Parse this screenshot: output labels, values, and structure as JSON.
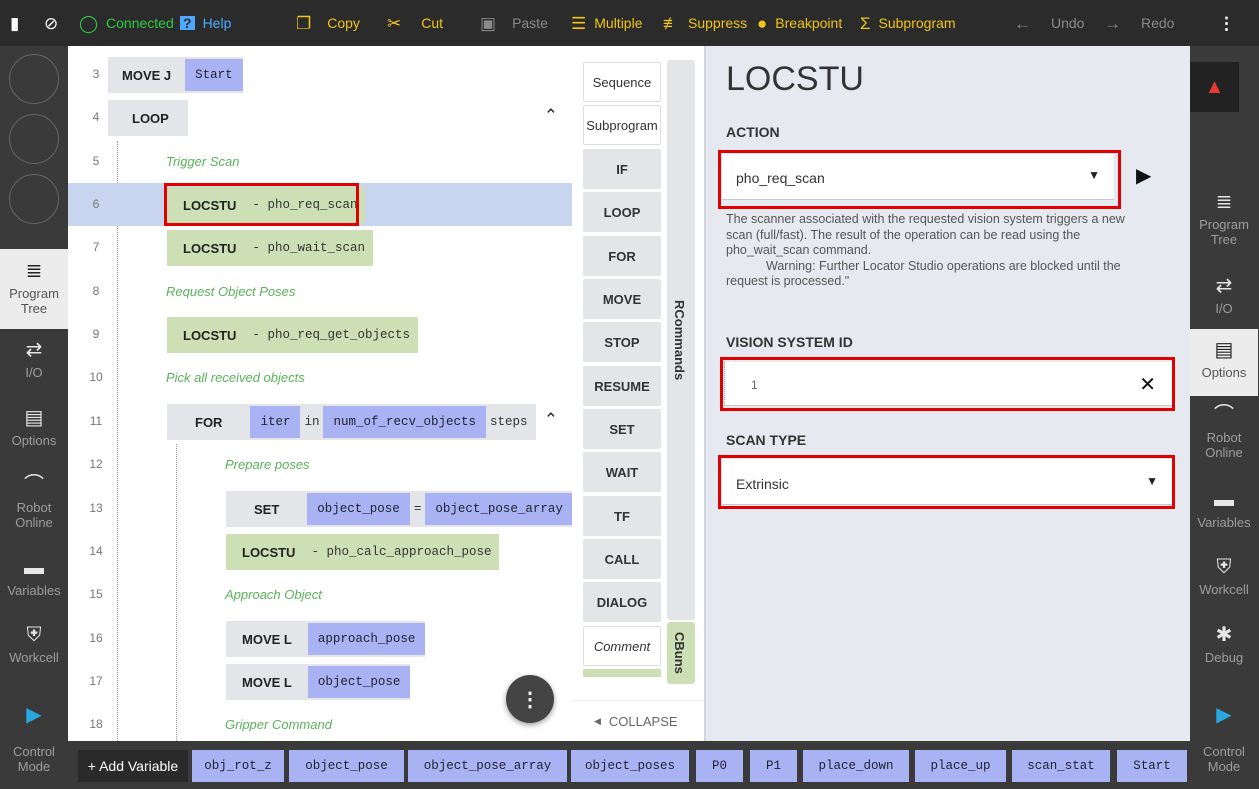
{
  "topbar": {
    "connected": "Connected",
    "help": "Help",
    "copy": "Copy",
    "cut": "Cut",
    "paste": "Paste",
    "multiple": "Multiple",
    "suppress": "Suppress",
    "breakpoint": "Breakpoint",
    "subprogram": "Subprogram",
    "undo": "Undo",
    "redo": "Redo"
  },
  "left_nav": {
    "program_tree": "Program Tree",
    "io": "I/O",
    "options": "Options",
    "robot_online": "Robot Online",
    "variables": "Variables",
    "workcell": "Workcell",
    "control_mode": "Control Mode"
  },
  "right_nav": {
    "program_tree": "Program Tree",
    "io": "I/O",
    "options": "Options",
    "robot_online": "Robot Online",
    "variables": "Variables",
    "workcell": "Workcell",
    "debug": "Debug",
    "control_mode": "Control Mode"
  },
  "tree": {
    "rows": [
      {
        "num": "3",
        "kw": "MOVE J",
        "arg": "Start"
      },
      {
        "num": "4",
        "kw": "LOOP"
      },
      {
        "num": "5",
        "comment": "Trigger Scan"
      },
      {
        "num": "6",
        "kw": "LOCSTU",
        "desc": "- pho_req_scan"
      },
      {
        "num": "7",
        "kw": "LOCSTU",
        "desc": "- pho_wait_scan"
      },
      {
        "num": "8",
        "comment": "Request Object Poses"
      },
      {
        "num": "9",
        "kw": "LOCSTU",
        "desc": "- pho_req_get_objects"
      },
      {
        "num": "10",
        "comment": "Pick all received objects"
      },
      {
        "num": "11",
        "kw": "FOR",
        "arg1": "iter",
        "in": "in",
        "arg2": "num_of_recv_objects",
        "steps": "steps"
      },
      {
        "num": "12",
        "comment": "Prepare poses"
      },
      {
        "num": "13",
        "kw": "SET",
        "arg1": "object_pose",
        "eq": "=",
        "arg2": "object_pose_array",
        "br": "["
      },
      {
        "num": "14",
        "kw": "LOCSTU",
        "desc": "- pho_calc_approach_pose"
      },
      {
        "num": "15",
        "comment": "Approach Object"
      },
      {
        "num": "16",
        "kw": "MOVE L",
        "arg": "approach_pose"
      },
      {
        "num": "17",
        "kw": "MOVE L",
        "arg": "object_pose"
      },
      {
        "num": "18",
        "comment": "Gripper Command"
      }
    ]
  },
  "commands": {
    "items": [
      "Sequence",
      "Subprogram",
      "IF",
      "LOOP",
      "FOR",
      "MOVE",
      "STOP",
      "RESUME",
      "SET",
      "WAIT",
      "TF",
      "CALL",
      "DIALOG",
      "Comment"
    ],
    "rcommands": "RCommands",
    "cbuns": "CBuns",
    "collapse": "COLLAPSE"
  },
  "detail": {
    "title": "LOCSTU",
    "action_label": "ACTION",
    "action_value": "pho_req_scan",
    "description": "The scanner associated with the requested vision system triggers a new scan (full/fast). The result of the operation can be read using the pho_wait_scan command.",
    "warning": "Warning: Further Locator Studio operations are blocked until the request is processed.\"",
    "vision_label": "VISION SYSTEM ID",
    "vision_value": "1",
    "scan_label": "SCAN TYPE",
    "scan_value": "Extrinsic"
  },
  "bottom": {
    "add_variable": "+ Add Variable",
    "variables": [
      "obj_rot_z",
      "object_pose",
      "object_pose_array",
      "object_poses",
      "P0",
      "P1",
      "place_down",
      "place_up",
      "scan_stat",
      "Start"
    ]
  },
  "colors": {
    "accent": "#f0c419",
    "connected": "#2ecc40",
    "selected": "#c9d4ee",
    "chip": "#a9b3f3",
    "locstu": "#cde0b5",
    "comment": "#5ab25a",
    "highlight": "#e00000"
  }
}
